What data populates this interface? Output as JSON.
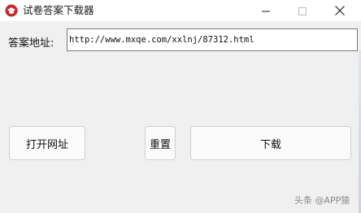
{
  "window": {
    "title": "试卷答案下载器",
    "app_icon": "red-cap-icon",
    "controls": {
      "minimize_icon": "minimize-icon",
      "maximize_icon": "maximize-icon",
      "close_icon": "close-icon"
    }
  },
  "form": {
    "url_label": "答案地址:",
    "url_value": "http://www.mxqe.com/xxlnj/87312.html"
  },
  "buttons": {
    "open_url": "打开网址",
    "reset": "重置",
    "download": "下载"
  },
  "watermark": "头条 @APP猿",
  "colors": {
    "window_bg": "#f0f0f0",
    "titlebar_bg": "#ffffff",
    "icon_red": "#c62828"
  }
}
